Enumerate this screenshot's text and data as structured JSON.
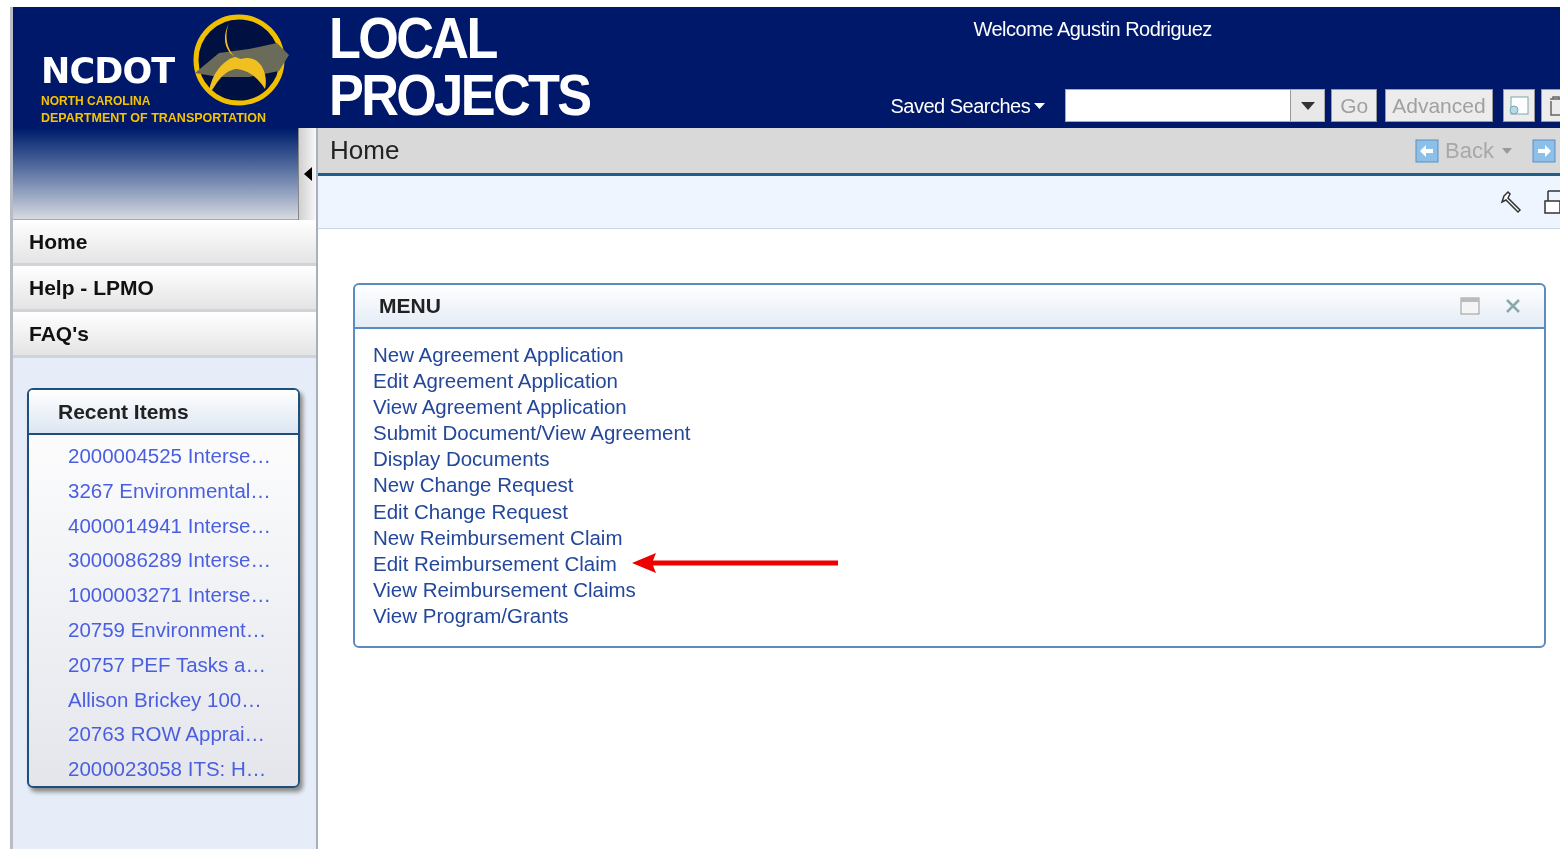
{
  "header": {
    "org": "NCDOT",
    "org_line_1": "NORTH CAROLINA",
    "org_line_2": "DEPARTMENT OF TRANSPORTATION",
    "app_title": [
      "LOCAL",
      "PROJECTS"
    ],
    "welcome": "Welcome Agustin Rodriguez"
  },
  "search": {
    "saved_searches": "Saved Searches",
    "go": "Go",
    "advanced": "Advanced"
  },
  "page_bar": {
    "title": "Home",
    "back": "Back"
  },
  "nav": [
    {
      "label": "Home"
    },
    {
      "label": "Help - LPMO"
    },
    {
      "label": "FAQ's"
    }
  ],
  "recent_items": {
    "title": "Recent Items",
    "items": [
      "2000004525 Interse…",
      "3267 Environmental…",
      "4000014941 Interse…",
      "3000086289 Interse…",
      "1000003271 Interse…",
      "20759 Environment…",
      "20757 PEF Tasks a…",
      "Allison Brickey 100…",
      "20763 ROW Apprai…",
      "2000023058 ITS: H…"
    ]
  },
  "menu": {
    "title": "MENU",
    "links": [
      "New Agreement Application",
      "Edit Agreement Application",
      "View Agreement Application",
      "Submit Document/View Agreement",
      "Display Documents",
      "New Change Request",
      "Edit Change Request",
      "New Reimbursement Claim",
      "Edit Reimbursement Claim",
      "View Reimbursement Claims",
      "View Program/Grants"
    ]
  }
}
